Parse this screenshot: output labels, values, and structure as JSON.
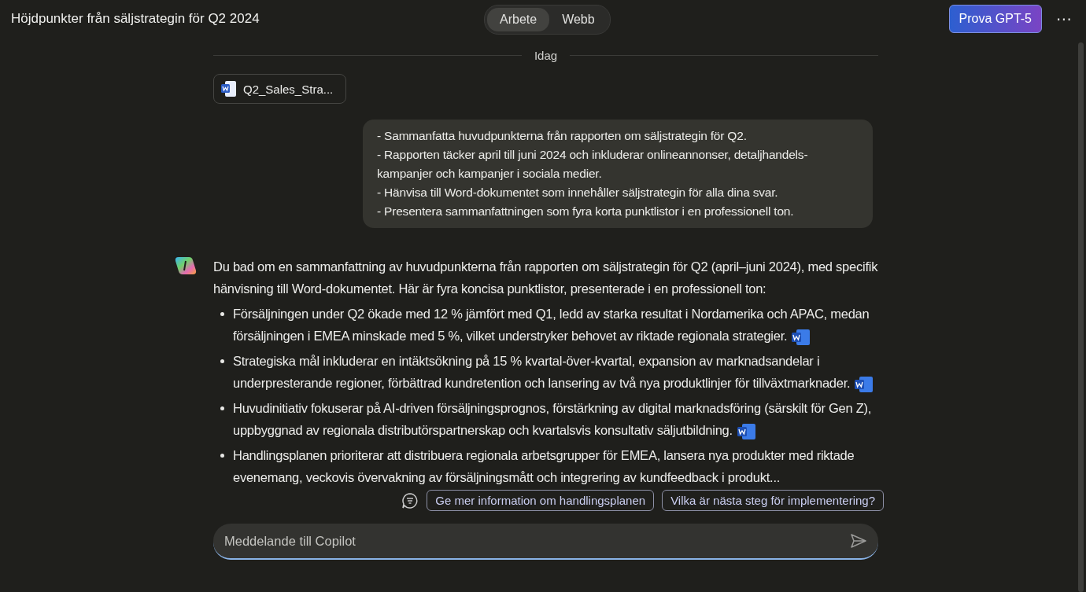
{
  "header": {
    "title": "Höjdpunkter från säljstrategin för Q2 2024",
    "tabs": [
      {
        "label": "Arbete",
        "selected": true
      },
      {
        "label": "Webb",
        "selected": false
      }
    ],
    "upgrade_button": "Prova GPT-5",
    "more_button": "⋯"
  },
  "divider_label": "Idag",
  "attachment": {
    "name": "Q2_Sales_Stra..."
  },
  "user_message": [
    "- Sammanfatta huvudpunkterna från rapporten om säljstrategin för Q2.",
    "- Rapporten täcker april till juni 2024 och inkluderar onlineannonser, detaljhandels-kampanjer och kampanjer i sociala medier.",
    "- Hänvisa till Word-dokumentet som innehåller säljstrategin för alla dina svar.",
    "- Presentera sammanfattningen som fyra korta punktlistor i en professionell ton."
  ],
  "answer": {
    "intro": "Du bad om en sammanfattning av huvudpunkterna från rapporten om säljstrategin för Q2 (april–juni 2024), med specifik hänvisning till Word-dokumentet. Här är fyra koncisa punktlistor, presenterade i en professionell ton:",
    "bullets": [
      {
        "text": "Försäljningen under Q2 ökade med 12 % jämfört med Q1, ledd av starka resultat i Nordamerika och APAC, medan försäljningen i EMEA minskade med 5 %, vilket understryker behovet av riktade regionala strategier.",
        "citation": true
      },
      {
        "text": "Strategiska mål inkluderar en intäktsökning på 15 % kvartal-över-kvartal, expansion av marknadsandelar i underpresterande regioner, förbättrad kundretention och lansering av två nya produktlinjer för tillväxtmarknader.",
        "citation": true
      },
      {
        "text": "Huvudinitiativ fokuserar på AI-driven försäljningsprognos, förstärkning av digital marknadsföring (särskilt för Gen Z), uppbyggnad av regionala distributörspartnerskap och kvartalsvis konsultativ säljutbildning.",
        "citation": true
      },
      {
        "text": "Handlingsplanen prioriterar att distribuera regionala arbetsgrupper för EMEA, lansera nya produkter med riktade evenemang, veckovis övervakning av försäljningsmått och integrering av kundfeedback i produkt...",
        "citation": false
      }
    ]
  },
  "suggestions": [
    "Ge mer information om handlingsplanen",
    "Vilka är nästa steg för implementering?"
  ],
  "composer": {
    "placeholder": "Meddelande till Copilot"
  }
}
